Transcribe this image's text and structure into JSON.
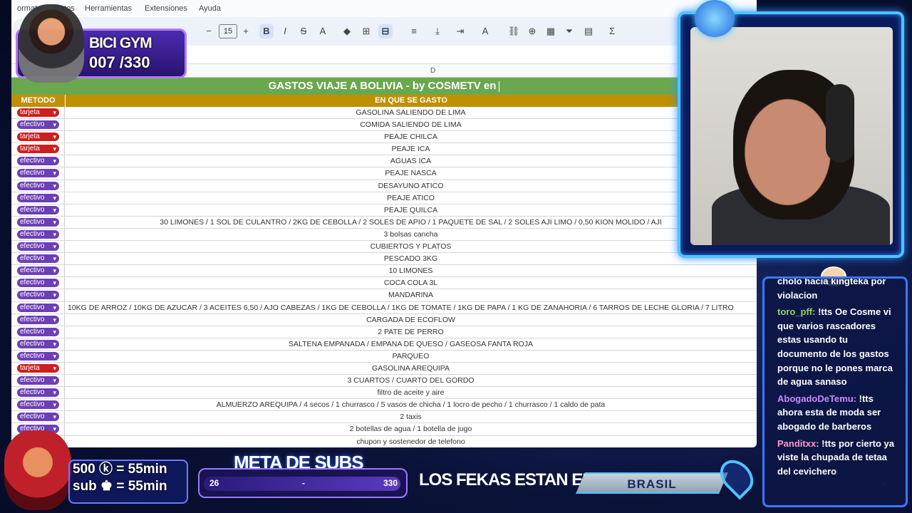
{
  "menubar": {
    "items": [
      "ormato",
      "Datos",
      "Herramientas",
      "Extensiones",
      "Ayuda"
    ]
  },
  "toolbar": {
    "font_size": "15",
    "minus": "−",
    "plus": "+",
    "bold": "B",
    "italic": "I",
    "strike": "S",
    "text_color": "A",
    "sum": "Σ"
  },
  "sheet": {
    "column_letter": "D",
    "title": "GASTOS VIAJE A BOLIVIA - by COSMETV en",
    "header_method": "METODO",
    "header_desc": "EN QUE SE GASTO",
    "rows": [
      {
        "method": "tarjeta",
        "desc": "GASOLINA SALIENDO DE LIMA"
      },
      {
        "method": "efectivo",
        "desc": "COMIDA SALIENDO DE LIMA"
      },
      {
        "method": "tarjeta",
        "desc": "PEAJE CHILCA"
      },
      {
        "method": "tarjeta",
        "desc": "PEAJE ICA"
      },
      {
        "method": "efectivo",
        "desc": "AGUAS ICA"
      },
      {
        "method": "efectivo",
        "desc": "PEAJE NASCA"
      },
      {
        "method": "efectivo",
        "desc": "DESAYUNO ATICO"
      },
      {
        "method": "efectivo",
        "desc": "PEAJE ATICO"
      },
      {
        "method": "efectivo",
        "desc": "PEAJE QUILCA"
      },
      {
        "method": "efectivo",
        "desc": "30 LIMONES / 1 SOL DE CULANTRO / 2KG DE CEBOLLA / 2 SOLES DE APIO / 1 PAQUETE DE SAL / 2 SOLES AJI LIMO / 0,50 KION MOLIDO / AJI"
      },
      {
        "method": "efectivo",
        "desc": "3 bolsas cancha"
      },
      {
        "method": "efectivo",
        "desc": "CUBIERTOS Y PLATOS"
      },
      {
        "method": "efectivo",
        "desc": "PESCADO 3KG"
      },
      {
        "method": "efectivo",
        "desc": "10 LIMONES"
      },
      {
        "method": "efectivo",
        "desc": "COCA COLA 3L"
      },
      {
        "method": "efectivo",
        "desc": "MANDARINA"
      },
      {
        "method": "efectivo",
        "desc": "10KG DE ARROZ / 10KG DE AZUCAR / 3 ACEITES 6,50 / AJO CABEZAS / 1KG DE CEBOLLA / 1KG DE TOMATE / 1KG DE PAPA / 1 KG DE ZANAHORIA / 6 TARROS DE LECHE GLORIA / 7 LITRO"
      },
      {
        "method": "efectivo",
        "desc": "CARGADA DE ECOFLOW"
      },
      {
        "method": "efectivo",
        "desc": "2 PATE DE PERRO"
      },
      {
        "method": "efectivo",
        "desc": "SALTENA EMPANADA / EMPANA DE QUESO / GASEOSA FANTA ROJA"
      },
      {
        "method": "efectivo",
        "desc": "PARQUEO"
      },
      {
        "method": "tarjeta",
        "desc": "GASOLINA AREQUIPA"
      },
      {
        "method": "efectivo",
        "desc": "3 CUARTOS / CUARTO DEL GORDO"
      },
      {
        "method": "efectivo",
        "desc": "filtro de aceite y aire"
      },
      {
        "method": "efectivo",
        "desc": "ALMUERZO AREQUIPA / 4 secos / 1 churrasco / 5 vasos de chicha / 1 locro de pecho / 1 churrasco / 1 caldo de pata"
      },
      {
        "method": "efectivo",
        "desc": "2 taxis"
      },
      {
        "method": "efectivo",
        "desc": "2 botellas de agua / 1 botella de jugo"
      },
      {
        "method": "efectivo",
        "desc": "chupon y sostenedor de telefono"
      }
    ]
  },
  "overlay": {
    "bicigym_title": "BICI GYM",
    "bicigym_count": "007 /330",
    "sub_line1": "500 ⓚ = 55min",
    "sub_line2": "sub ♚ = 55min",
    "meta_title": "META DE SUBS",
    "meta_current": "26",
    "meta_sep": "-",
    "meta_goal": "330",
    "meta_progress": 0.079,
    "fekas_label": "LOS FEKAS ESTAN EN:",
    "country": "BRASIL"
  },
  "chat": [
    {
      "user": "",
      "text": "cholo hacia kingteka por violacion"
    },
    {
      "user": "toro_pff:",
      "text": "!tts Oe Cosme vi que varios rascadores estas usando tu documento de los gastos porque no le pones marca de agua sanaso"
    },
    {
      "user": "AbogadoDeTemu:",
      "text": "!tts ahora esta de moda ser abogado de barberos"
    },
    {
      "user": "Panditxx:",
      "text": "!tts por cierto ya viste la chupada de tetaa del cevichero"
    }
  ],
  "colors": {
    "green": "#6aa84f",
    "gold": "#bf9000",
    "efectivo": "#6d3fb5",
    "tarjeta": "#cc1f1f"
  }
}
